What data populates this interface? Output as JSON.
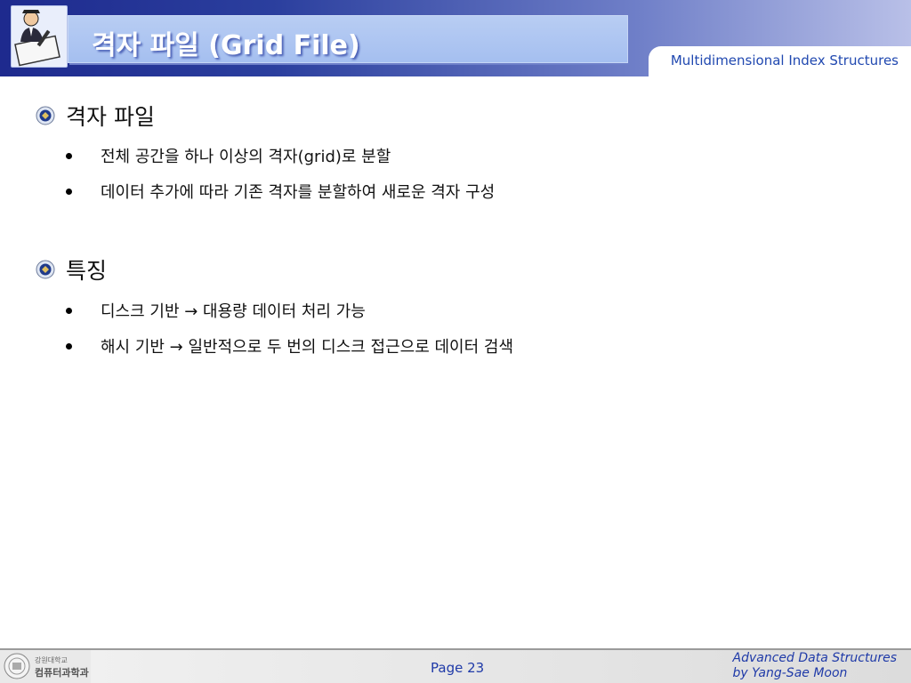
{
  "header": {
    "title": "격자 파일 (Grid File)",
    "subtitle": "Multidimensional Index Structures",
    "logo_icon": "presenter-with-pen-icon"
  },
  "sections": [
    {
      "title": "격자 파일",
      "icon": "university-emblem-icon",
      "bullets": [
        "전체 공간을 하나 이상의 격자(grid)로 분할",
        "데이터 추가에 따라 기존 격자를 분할하여 새로운 격자 구성"
      ]
    },
    {
      "title": "특징",
      "icon": "university-emblem-icon",
      "bullets": [
        "디스크 기반 → 대용량 데이터 처리 가능",
        "해시 기반 → 일반적으로 두 번의 디스크 접근으로 데이터 검색"
      ]
    }
  ],
  "footer": {
    "logo_line1": "강원대학교",
    "logo_line2": "컴퓨터과학과",
    "page": "Page 23",
    "credit_line1": "Advanced Data Structures",
    "credit_line2": "by Yang-Sae Moon"
  },
  "colors": {
    "header_dark": "#1e2a8e",
    "title_box": "#a5bff0",
    "accent_text": "#1f3aa8"
  }
}
